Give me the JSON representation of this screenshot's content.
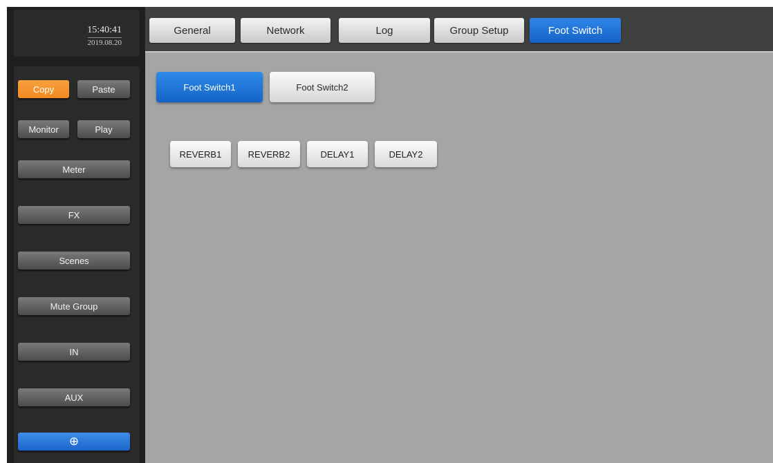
{
  "clock": {
    "time": "15:40:41",
    "date": "2019.08.20"
  },
  "tabs": [
    "General",
    "Network",
    "Log",
    "Group Setup",
    "Foot Switch"
  ],
  "active_tab": "Foot Switch",
  "sidebar": {
    "copy": "Copy",
    "paste": "Paste",
    "monitor": "Monitor",
    "play": "Play",
    "items": [
      "Meter",
      "FX",
      "Scenes",
      "Mute Group",
      "IN",
      "AUX"
    ],
    "bottom_icon": "⊕"
  },
  "subtabs": [
    "Foot Switch1",
    "Foot Switch2"
  ],
  "active_subtab": "Foot Switch1",
  "assignments": [
    "REVERB1",
    "REVERB2",
    "DELAY1",
    "DELAY2"
  ],
  "colors": {
    "accent_blue": "#1c6fd3",
    "copy_orange": "#f28a1f",
    "content_bg": "#a3a5a6",
    "panel_dark": "#2a2a2a"
  }
}
